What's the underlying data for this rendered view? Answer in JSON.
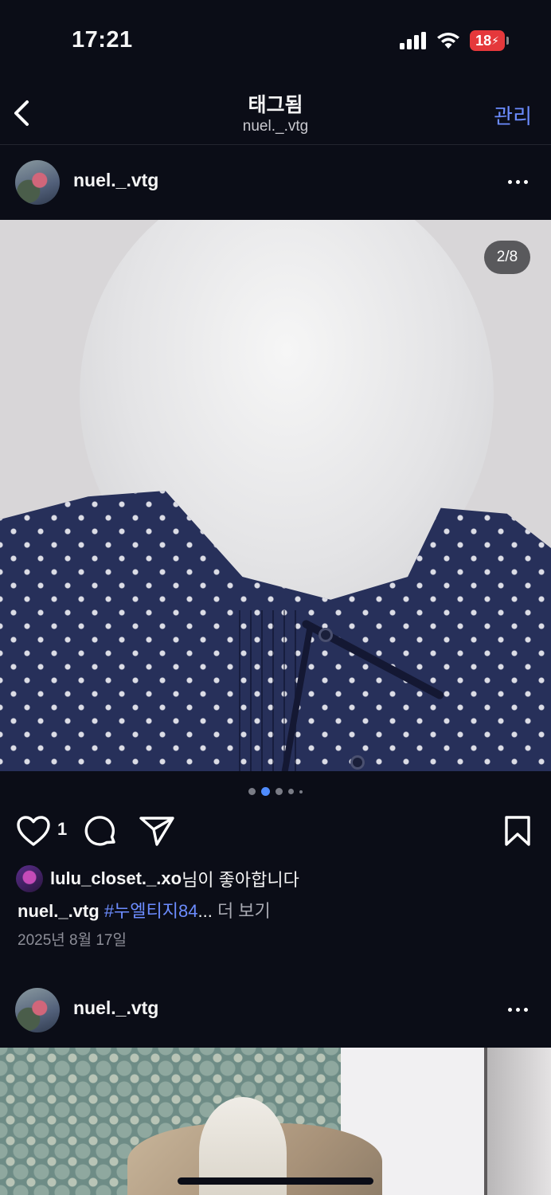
{
  "status_bar": {
    "time": "17:21",
    "battery": "18",
    "icons": [
      "signal-icon",
      "wifi-icon",
      "battery-charging-icon"
    ]
  },
  "nav": {
    "title": "태그됨",
    "subtitle": "nuel._.vtg",
    "manage": "관리"
  },
  "post1": {
    "username": "nuel._.vtg",
    "counter": "2/8",
    "carousel": {
      "total_dots": 5,
      "active_index": 1
    },
    "like_count": "1",
    "liked_by": "lulu_closet._.xo",
    "liked_suffix": "님이 좋아합니다",
    "caption_user": "nuel._.vtg",
    "caption_tag": "#누엘티지84",
    "caption_ellipsis": "...",
    "caption_more": "더 보기",
    "date": "2025년 8월 17일"
  },
  "post2": {
    "username": "nuel._.vtg"
  },
  "colors": {
    "background": "#0b0d17",
    "accent": "#6c8cff",
    "active_dot": "#4f8cff"
  }
}
